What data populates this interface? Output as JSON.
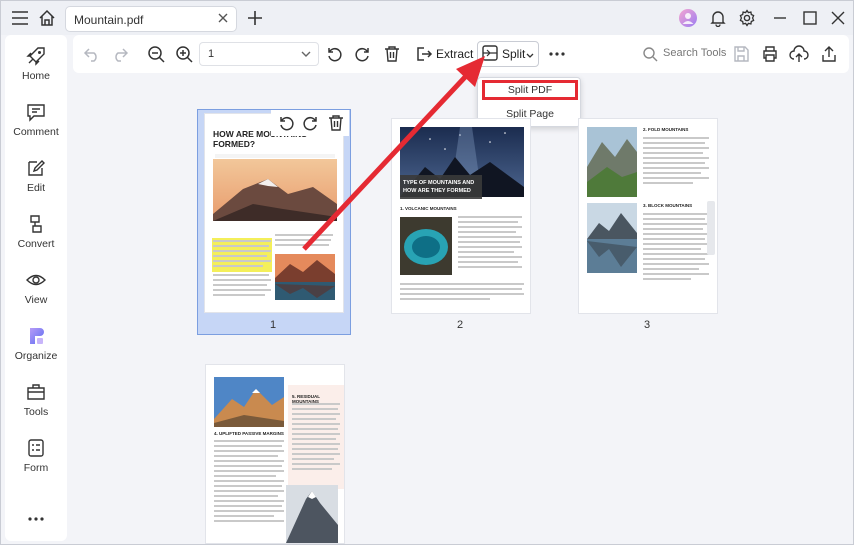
{
  "titlebar": {
    "tab_label": "Mountain.pdf"
  },
  "sidebar": {
    "items": [
      {
        "label": "Home",
        "icon": "rocket-icon"
      },
      {
        "label": "Comment",
        "icon": "comment-icon"
      },
      {
        "label": "Edit",
        "icon": "edit-icon"
      },
      {
        "label": "Convert",
        "icon": "convert-icon"
      },
      {
        "label": "View",
        "icon": "eye-icon"
      },
      {
        "label": "Organize",
        "icon": "organize-icon"
      },
      {
        "label": "Tools",
        "icon": "toolbox-icon"
      },
      {
        "label": "Form",
        "icon": "form-icon"
      }
    ]
  },
  "toolbar": {
    "page_value": "1",
    "extract_label": "Extract",
    "split_label": "Split",
    "search_placeholder": "Search Tools"
  },
  "split_menu": {
    "items": [
      "Split PDF",
      "Split Page"
    ]
  },
  "pages": {
    "p1": {
      "number": "1",
      "heading": "HOW ARE MOUNTAINS FORMED?"
    },
    "p2": {
      "number": "2",
      "heading": "TYPE OF MOUNTAINS AND HOW ARE THEY FORMED",
      "subheading": "1. VOLCANIC MOUNTAINS"
    },
    "p3": {
      "number": "3",
      "subheading_1": "2. FOLD MOUNTAINS",
      "subheading_2": "3. BLOCK MOUNTAINS"
    },
    "p4": {
      "subheading_1": "4. UPLIFTED PASSIVE MARGINS",
      "subheading_2": "5. RESIDUAL MOUNTAINS"
    }
  },
  "colors": {
    "accent_red": "#e52a33",
    "selection_blue": "#7b9ee0",
    "highlight_yellow": "#f4ef5a"
  }
}
